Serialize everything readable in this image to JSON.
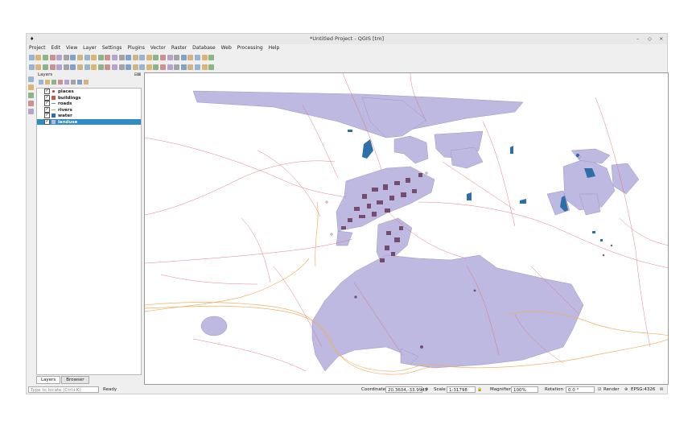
{
  "window": {
    "title": "*Untitled Project - QGIS [tm]",
    "app_icon": "♦",
    "minimize": "–",
    "restore": "◇",
    "close": "×"
  },
  "menu": [
    "Project",
    "Edit",
    "View",
    "Layer",
    "Settings",
    "Plugins",
    "Vector",
    "Raster",
    "Database",
    "Web",
    "Processing",
    "Help"
  ],
  "toolbar1_icons": [
    "new-project-icon",
    "open-project-icon",
    "save-icon",
    "save-as-icon",
    "print-layout-icon",
    "layout-manager-icon",
    "pan-icon",
    "pan-to-selection-icon",
    "zoom-in-icon",
    "zoom-out-icon",
    "zoom-full-icon",
    "zoom-selection-icon",
    "zoom-layer-icon",
    "zoom-last-icon",
    "zoom-next-icon",
    "new-bookmark-icon",
    "show-bookmarks-icon",
    "refresh-icon",
    "identify-icon",
    "select-icon",
    "deselect-icon",
    "attribute-table-icon",
    "field-calc-icon",
    "statistics-icon",
    "measure-icon",
    "annotation-icon",
    "tips-icon"
  ],
  "toolbar2_icons": [
    "toggle-edit-icon",
    "pencil-icon",
    "save-edits-icon",
    "add-feature-icon",
    "move-feature-icon",
    "node-tool-icon",
    "delete-icon",
    "cut-icon",
    "copy-icon",
    "paste-icon",
    "undo-icon",
    "redo-icon",
    "label-icon",
    "label-pin-icon",
    "label-show-icon",
    "label-move-icon",
    "label-rotate-icon",
    "label-change-icon",
    "label-tool-icon",
    "georef-icon",
    "add-wms-icon",
    "browser-icon",
    "python-icon",
    "digitize-icon",
    "processing-icon",
    "text-icon",
    "help-icon"
  ],
  "side_icons": [
    "add-vector-icon",
    "add-raster-icon",
    "add-postgis-icon",
    "add-wms-side-icon",
    "add-csv-icon"
  ],
  "layers_panel": {
    "title": "Layers",
    "controls": "⊟⊠",
    "toolbar_icons": [
      "style-icon",
      "add-group-icon",
      "visibility-icon",
      "filter-icon",
      "filter-legend-icon",
      "expand-icon",
      "collapse-icon",
      "remove-layer-icon"
    ],
    "items": [
      {
        "label": "places",
        "checked": "✓",
        "swatch": "#c0392b",
        "kind": "point"
      },
      {
        "label": "buildings",
        "checked": "✓",
        "swatch": "#c05a4a",
        "kind": "fill"
      },
      {
        "label": "roads",
        "checked": "✓",
        "swatch": "#888888",
        "kind": "line"
      },
      {
        "label": "rivers",
        "checked": "✓",
        "swatch": "#d4a24a",
        "kind": "line"
      },
      {
        "label": "water",
        "checked": "✓",
        "swatch": "#2f6fa8",
        "kind": "fill"
      },
      {
        "label": "landuse",
        "checked": "✓",
        "swatch": "#bcb8e0",
        "kind": "fill",
        "selected": true
      }
    ],
    "tabs": [
      "Layers",
      "Browser"
    ]
  },
  "status": {
    "locator_placeholder": "Type to locate (Ctrl+K)",
    "ready": "Ready",
    "coordinate_label": "Coordinate",
    "coordinate_value": "20.3604,-33.9947",
    "scale_label": "Scale",
    "scale_value": "1:31798",
    "magnifier_label": "Magnifier",
    "magnifier_value": "100%",
    "rotation_label": "Rotation",
    "rotation_value": "0.0 °",
    "render_label": "Render",
    "crs": "EPSG:4326"
  },
  "colors": {
    "landuse": "#bdb9e0",
    "landuse_edge": "#9c96c8",
    "water": "#2f6fa8",
    "roads": "#e0707a",
    "rivers": "#f0b060",
    "buildings": "#6a3a5a",
    "selection": "#308cc6"
  }
}
